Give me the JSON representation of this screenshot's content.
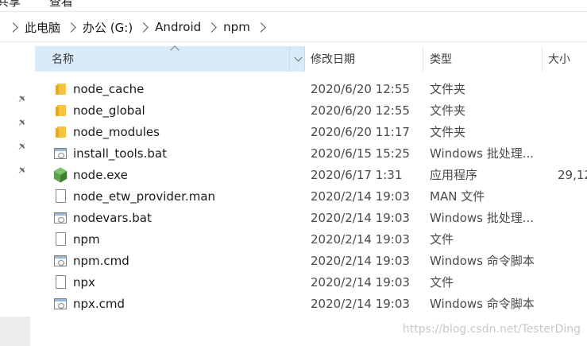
{
  "ribbon": {
    "tabs": [
      "共享",
      "查看"
    ]
  },
  "breadcrumb": {
    "items": [
      "此电脑",
      "办公 (G:)",
      "Android",
      "npm"
    ]
  },
  "columns": {
    "name": "名称",
    "date": "修改日期",
    "type": "类型",
    "size": "大小"
  },
  "files": [
    {
      "name": "node_cache",
      "date": "2020/6/20 12:55",
      "type": "文件夹",
      "size": "",
      "icon": "folder-icon"
    },
    {
      "name": "node_global",
      "date": "2020/6/20 12:55",
      "type": "文件夹",
      "size": "",
      "icon": "folder-icon"
    },
    {
      "name": "node_modules",
      "date": "2020/6/20 11:17",
      "type": "文件夹",
      "size": "",
      "icon": "folder-icon"
    },
    {
      "name": "install_tools.bat",
      "date": "2020/6/15 15:25",
      "type": "Windows 批处理...",
      "size": "",
      "icon": "batch-file-icon"
    },
    {
      "name": "node.exe",
      "date": "2020/6/17 1:31",
      "type": "应用程序",
      "size": "29,12",
      "icon": "nodejs-icon"
    },
    {
      "name": "node_etw_provider.man",
      "date": "2020/2/14 19:03",
      "type": "MAN 文件",
      "size": "",
      "icon": "file-icon"
    },
    {
      "name": "nodevars.bat",
      "date": "2020/2/14 19:03",
      "type": "Windows 批处理...",
      "size": "",
      "icon": "batch-file-icon"
    },
    {
      "name": "npm",
      "date": "2020/2/14 19:03",
      "type": "文件",
      "size": "",
      "icon": "file-icon"
    },
    {
      "name": "npm.cmd",
      "date": "2020/2/14 19:03",
      "type": "Windows 命令脚本",
      "size": "",
      "icon": "batch-file-icon"
    },
    {
      "name": "npx",
      "date": "2020/2/14 19:03",
      "type": "文件",
      "size": "",
      "icon": "file-icon"
    },
    {
      "name": "npx.cmd",
      "date": "2020/2/14 19:03",
      "type": "Windows 命令脚本",
      "size": "",
      "icon": "batch-file-icon"
    }
  ],
  "watermark": "https://blog.csdn.net/TesterDing",
  "colors": {
    "header_selected": "#d9ebf9",
    "folder": "#f5c542",
    "nodejs": "#5fa04e"
  }
}
